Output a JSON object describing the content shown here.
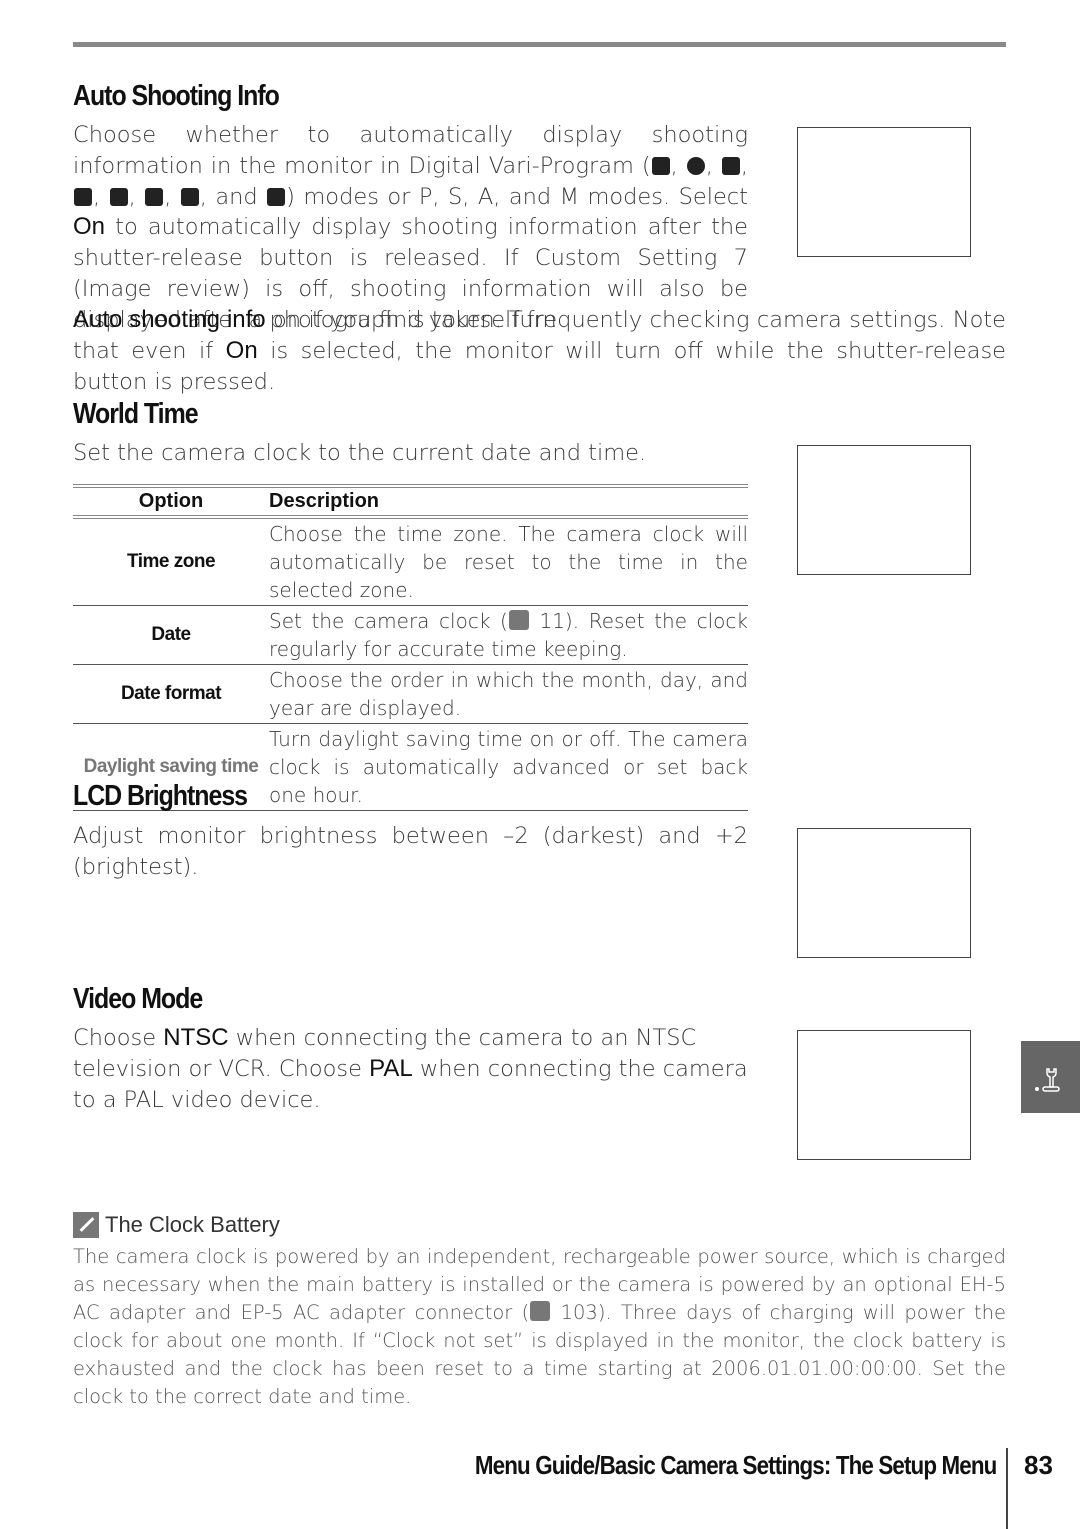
{
  "auto_shooting_info": {
    "title": "Auto Shooting Info",
    "text_1": "Choose whether to automatically display shooting information in the monitor in Digital Vari-Program (",
    "mode_icons": [
      "auto-icon",
      "flash-off-icon",
      "portrait-icon",
      "landscape-icon",
      "child-icon",
      "sports-icon",
      "close-up-icon",
      "night-portrait-icon"
    ],
    "and": "and",
    "text_2": ") modes or P, S, A, and M modes.  Select",
    "on": "On",
    "text_3": "to automatically display shooting information after the shutter-release button is released. If Custom Setting 7 (Image review) is off, shooting information will also be displayed after a photograph is taken.  Turn",
    "auto_shooting_info_label": "Auto shooting info",
    "text_4": "on if you find yourself frequently checking camera settings.  Note that even if",
    "text_5": "is selected, the monitor will turn off while the shutter-release button is pressed."
  },
  "world_time": {
    "title": "World Time",
    "intro": "Set the camera clock to the current date and time.",
    "table": {
      "headers": [
        "Option",
        "Description"
      ],
      "rows": [
        {
          "option": "Time zone",
          "description": "Choose the time zone.  The camera clock will automatically be reset to the time in the selected zone."
        },
        {
          "option": "Date",
          "description_a": "Set the camera clock (",
          "description_b": "11).  Reset the clock regularly for accurate time keeping."
        },
        {
          "option": "Date format",
          "description": "Choose the order in which the month, day, and year are displayed."
        },
        {
          "option": "Daylight saving time",
          "description": "Turn daylight saving time on or off.  The camera clock is automatically advanced or set back one hour."
        }
      ]
    }
  },
  "lcd_brightness": {
    "title": "LCD Brightness",
    "text": "Adjust monitor brightness between –2 (darkest) and +2 (brightest)."
  },
  "video_mode": {
    "title": "Video Mode",
    "t1": "Choose",
    "ntsc": "NTSC",
    "t2": "when connecting the camera to an NTSC television or VCR.  Choose",
    "pal": "PAL",
    "t3": "when connecting the camera to a PAL video device."
  },
  "note": {
    "title": "The Clock Battery",
    "text_a": "The camera clock is powered by an independent, rechargeable power source, which is charged as necessary when the main battery is installed or the camera is powered by an optional EH-5 AC adapter and EP-5 AC adapter connector (",
    "text_b": "103).  Three days of charging will power the clock for about one month.  If “Clock not set” is displayed in the monitor, the clock battery is exhausted and the clock has been reset to a time starting at 2006.01.01.00:00:00.  Set the clock to the correct date and time."
  },
  "footer": {
    "section": "Menu Guide/Basic Camera Settings: The Setup Menu",
    "page": "83"
  },
  "side_tab_icon": "setup-wrench-icon"
}
